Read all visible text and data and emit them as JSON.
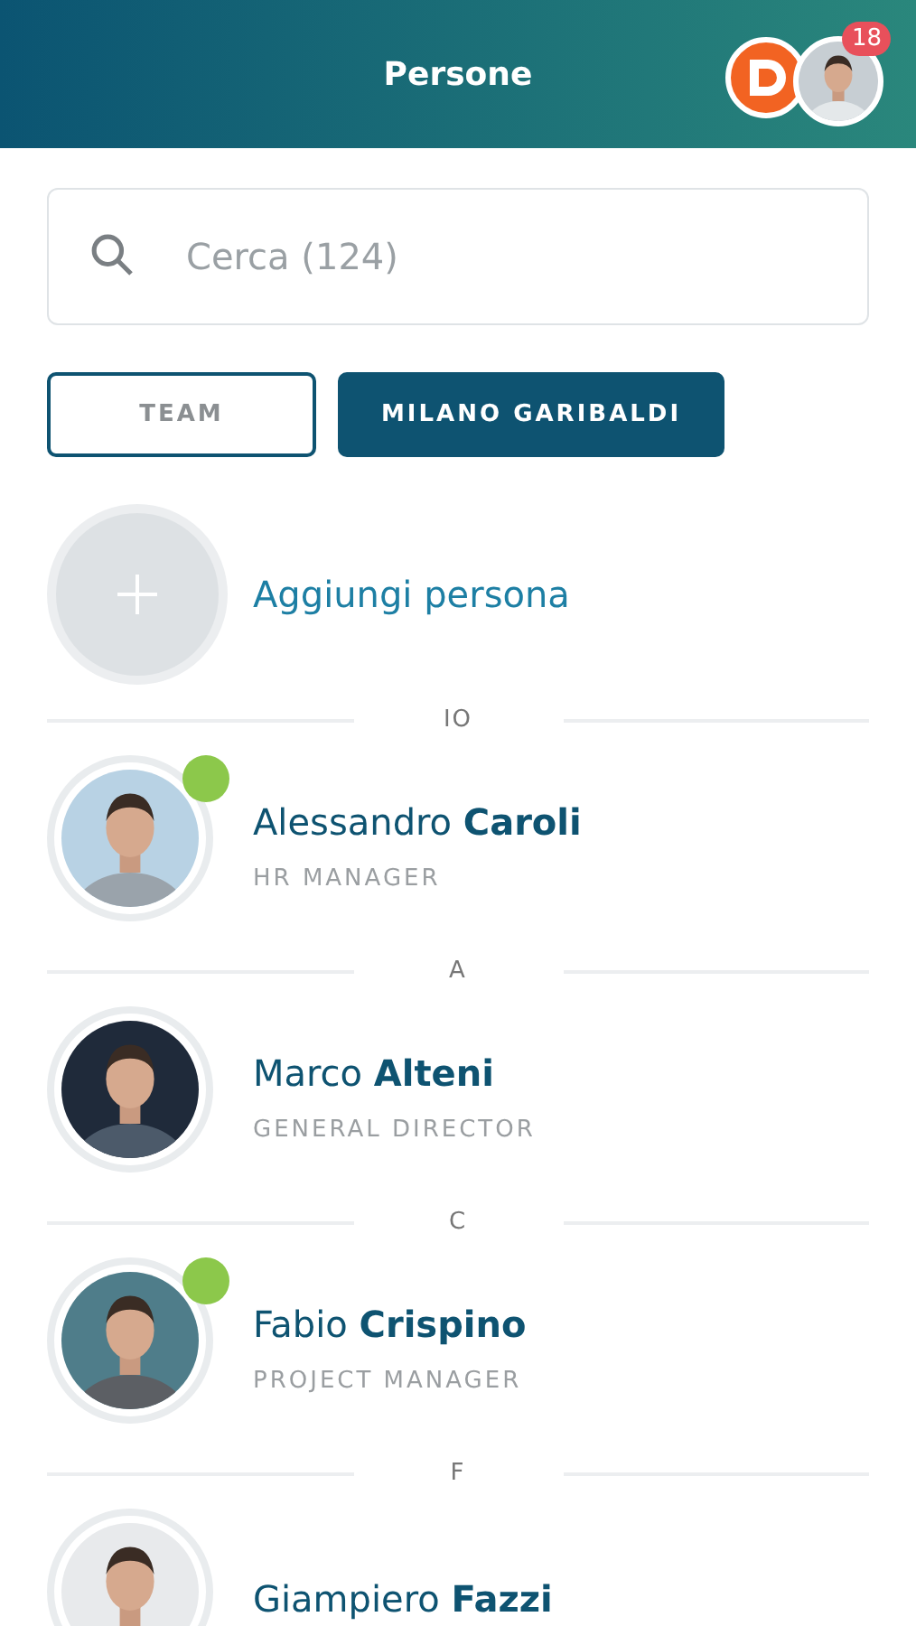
{
  "header": {
    "title": "Persone",
    "badge": "18"
  },
  "search": {
    "placeholder": "Cerca (124)"
  },
  "tabs": [
    {
      "label": "TEAM",
      "selected": false
    },
    {
      "label": "MILANO GARIBALDI",
      "selected": true
    }
  ],
  "add_person": {
    "label": "Aggiungi persona"
  },
  "sections": [
    {
      "letter": "IO",
      "people": [
        {
          "name": "Alessandro **Caroli**",
          "role": "HR MANAGER",
          "online": true
        }
      ]
    },
    {
      "letter": "A",
      "people": [
        {
          "name": "Marco **Alteni**",
          "role": "GENERAL DIRECTOR",
          "online": false
        }
      ]
    },
    {
      "letter": "C",
      "people": [
        {
          "name": "Fabio **Crispino**",
          "role": "PROJECT MANAGER",
          "online": true
        }
      ]
    },
    {
      "letter": "F",
      "people": [
        {
          "name": "Giampiero **Fazzi**",
          "online": false
        }
      ]
    }
  ]
}
